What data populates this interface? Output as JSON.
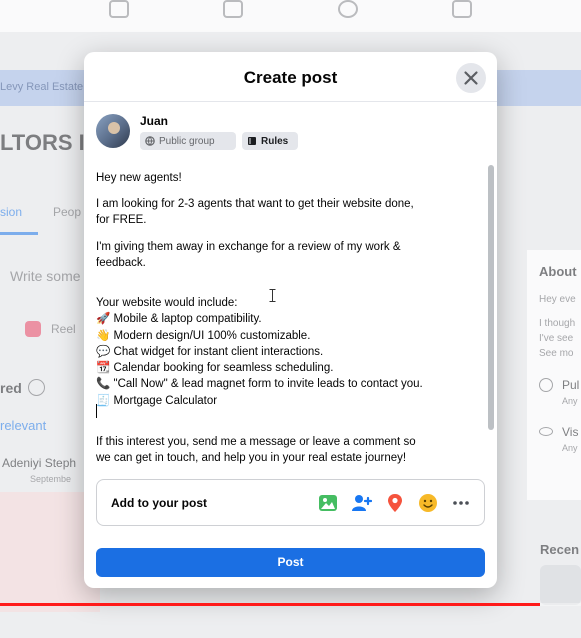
{
  "background": {
    "banner_text": "Levy Real Estate",
    "group_title": "LTORS In",
    "tabs": [
      "sion",
      "Peop"
    ],
    "composer_placeholder": "Write some",
    "reel_label": "Reel",
    "featured_label": "red",
    "sort_label": "relevant",
    "author_name": "Adeniyi Steph",
    "author_meta": "Septembe",
    "about": {
      "title": "About",
      "lines": [
        "Hey eve",
        "I though",
        "I've see",
        "See mo"
      ],
      "privacy_label": "Pul",
      "privacy_sub": "Any",
      "visibility_label": "Vis",
      "visibility_sub": "Any"
    },
    "recent_label": "Recen"
  },
  "modal": {
    "title": "Create post",
    "user_name": "Juan",
    "audience_label": "Public group",
    "rules_label": "Rules",
    "body_lines": [
      "Hey new agents!",
      "I am looking for 2-3 agents that want to get their website done,",
      "for FREE.",
      "I'm giving them away in exchange for a review of my work &",
      "feedback.",
      "Your website would include:",
      "🚀 Mobile & laptop compatibility.",
      "👋 Modern design/UI 100% customizable.",
      "💬 Chat widget for instant client interactions.",
      "📆 Calendar booking for seamless scheduling.",
      "📞 \"Call Now\" & lead magnet form to invite leads to contact you.",
      "🧾 Mortgage Calculator",
      "If this interest you, send me a message or leave a comment so",
      "we can get in touch, and help you in your real estate journey!"
    ],
    "add_to_post_label": "Add to your post",
    "post_button_label": "Post"
  },
  "video_progress": 0.93,
  "colors": {
    "accent": "#1b6fe3",
    "photo_icon": "#45bd62",
    "tag_icon": "#1877f2",
    "location_icon": "#f5533d",
    "feeling_icon": "#f7b928",
    "progress": "#ff1a1a"
  }
}
